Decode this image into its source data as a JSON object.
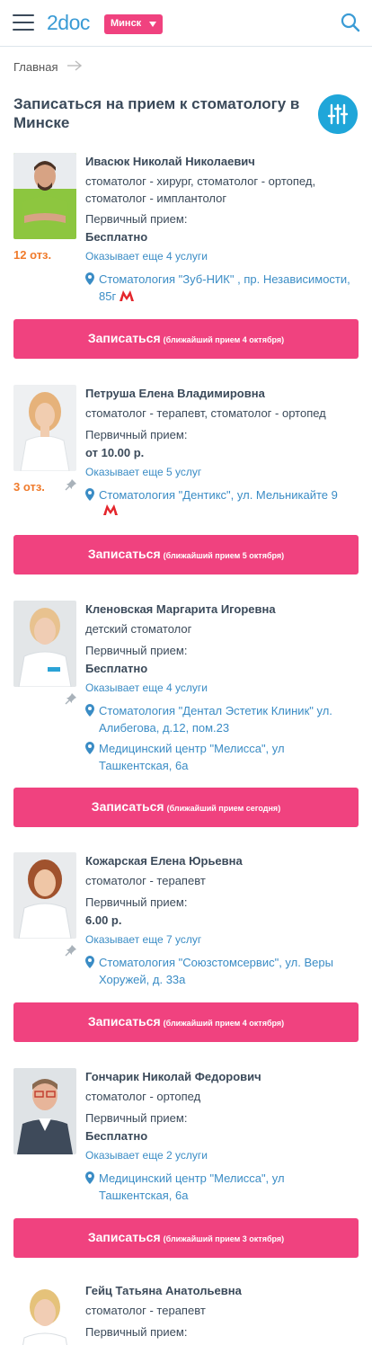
{
  "header": {
    "logo": "2doc",
    "city": "Минск",
    "menu_icon": "hamburger-icon",
    "search_icon": "search-icon"
  },
  "breadcrumb": {
    "home": "Главная"
  },
  "page_title": "Записаться на прием к стоматологу в Минске",
  "colors": {
    "accent": "#f0427f",
    "link": "#3a8cc5",
    "brand": "#3a9bd5",
    "reviews": "#f07b2c",
    "filter": "#1fa6d9"
  },
  "doctors": [
    {
      "name": "Ивасюк Николай Николаевич",
      "specialty": "стоматолог - хирург, стоматолог - ортопед, стоматолог - имплантолог",
      "primary_label": "Первичный прием:",
      "price": "Бесплатно",
      "reviews": "12 отз.",
      "more_services": "Оказывает еще 4 услуги",
      "addresses": [
        "Стоматология \"Зуб-НИК\" , пр. Независимости, 85г"
      ],
      "book_label": "Записаться",
      "book_note": "(ближайший прием 4 октября)"
    },
    {
      "name": "Петруша Елена Владимировна",
      "specialty": "стоматолог - терапевт, стоматолог - ортопед",
      "primary_label": "Первичный прием:",
      "price": "от 10.00 р.",
      "reviews": "3 отз.",
      "more_services": "Оказывает еще 5 услуг",
      "addresses": [
        "Стоматология \"Дентикс\", ул. Мельникайте 9"
      ],
      "book_label": "Записаться",
      "book_note": "(ближайший прием 5 октября)"
    },
    {
      "name": "Кленовская Маргарита Игоревна",
      "specialty": "детский стоматолог",
      "primary_label": "Первичный прием:",
      "price": "Бесплатно",
      "more_services": "Оказывает еще 4 услуги",
      "addresses": [
        "Стоматология \"Дентал Эстетик Клиник\" ул. Алибегова, д.12, пом.23",
        "Медицинский центр \"Мелисса\", ул Ташкентская, 6а"
      ],
      "book_label": "Записаться",
      "book_note": "(ближайший прием сегодня)"
    },
    {
      "name": "Кожарская Елена Юрьевна",
      "specialty": "стоматолог - терапевт",
      "primary_label": "Первичный прием:",
      "price": "6.00 р.",
      "more_services": "Оказывает еще 7 услуг",
      "addresses": [
        "Стоматология \"Союзстомсервис\", ул. Веры Хоружей, д. 33а"
      ],
      "book_label": "Записаться",
      "book_note": "(ближайший прием 4 октября)"
    },
    {
      "name": "Гончарик Николай Федорович",
      "specialty": "стоматолог - ортопед",
      "primary_label": "Первичный прием:",
      "price": "Бесплатно",
      "more_services": "Оказывает еще 2 услуги",
      "addresses": [
        "Медицинский центр \"Мелисса\", ул Ташкентская, 6а"
      ],
      "book_label": "Записаться",
      "book_note": "(ближайший прием 3 октября)"
    },
    {
      "name": "Гейц Татьяна Анатольевна",
      "specialty": "стоматолог - терапевт",
      "primary_label": "Первичный прием:"
    }
  ]
}
